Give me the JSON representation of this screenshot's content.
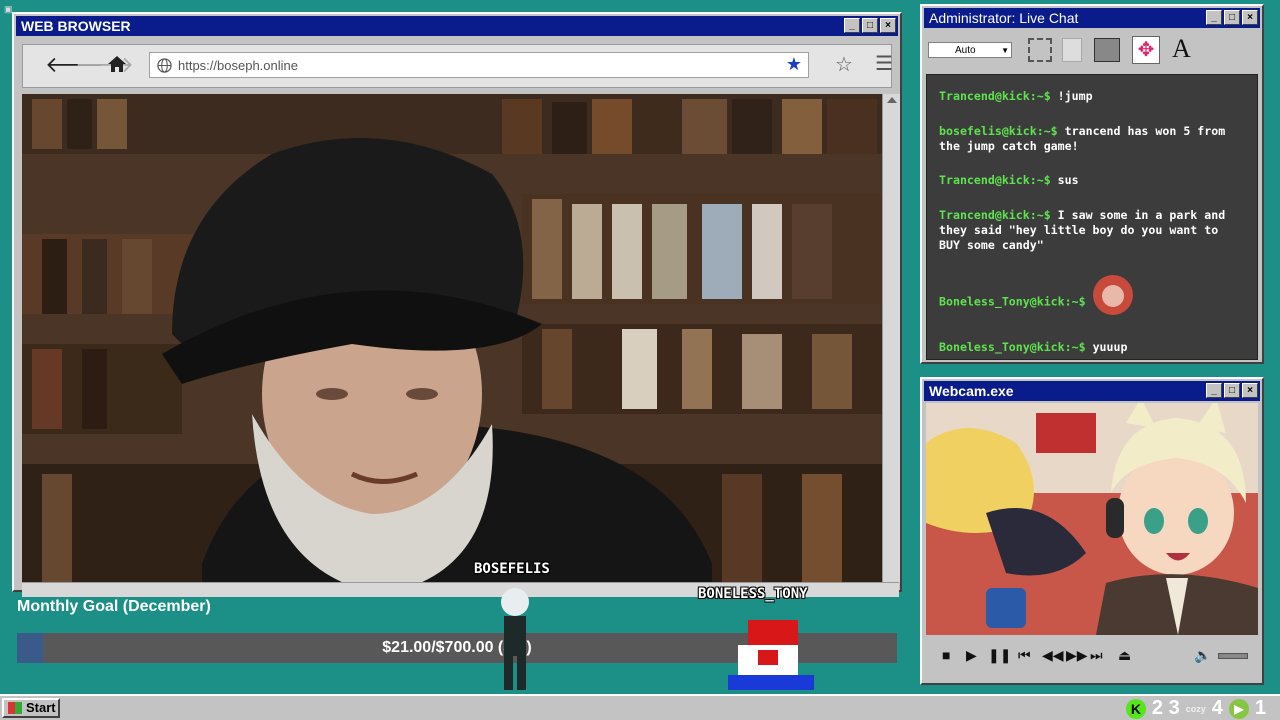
{
  "browser": {
    "title": "WEB BROWSER",
    "url": "https://boseph.online",
    "back_icon": "arrow-left-icon",
    "forward_icon": "arrow-right-icon",
    "home_icon": "home-icon"
  },
  "chat": {
    "title": "Administrator: Live Chat",
    "font_select": "Auto",
    "messages": [
      {
        "user": "Trancend@kick:~$",
        "text": "!jump"
      },
      {
        "user": "bosefelis@kick:~$",
        "text": "trancend has won 5 from the jump catch game!"
      },
      {
        "user": "Trancend@kick:~$",
        "text": "sus"
      },
      {
        "user": "Trancend@kick:~$",
        "text": "I saw some in a park and they said \"hey little boy do you want to BUY some candy\""
      },
      {
        "user": "Boneless_Tony@kick:~$",
        "text": ""
      },
      {
        "user": "Boneless_Tony@kick:~$",
        "text": "yuuup"
      }
    ]
  },
  "webcam": {
    "title": "Webcam.exe"
  },
  "goal": {
    "title": "Monthly Goal (December)",
    "text": "$21.00/$700.00 (3%)",
    "progress": 0.03
  },
  "overlay": {
    "user1": "BOSEFELIS",
    "user2": "BONELESS_TONY"
  },
  "taskbar": {
    "start_label": "Start",
    "kick_count": "2 3",
    "cozy_label": "cozy",
    "cozy_count": "4",
    "rumble_count": "1"
  },
  "colors": {
    "desktop": "#1c8f86",
    "titlebar": "#0a1b8c",
    "chat_user": "#5ee34f"
  }
}
